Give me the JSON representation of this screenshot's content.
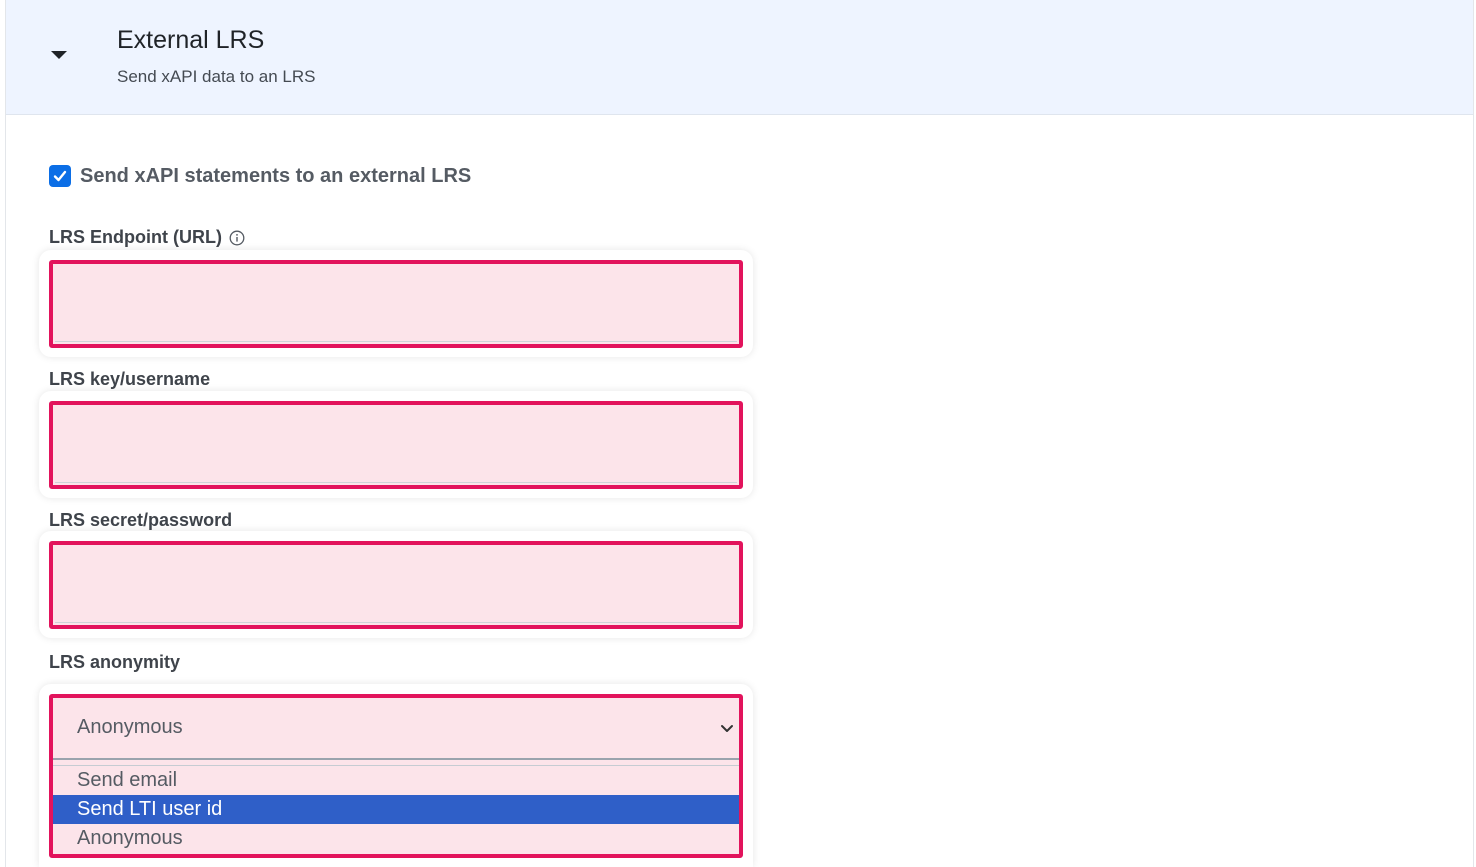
{
  "header": {
    "title": "External LRS",
    "subtitle": "Send xAPI data to an LRS",
    "toggle_icon": "caret-down-icon"
  },
  "send_checkbox": {
    "label": "Send xAPI statements to an external LRS",
    "checked": true,
    "accent_color": "#0b6ee6"
  },
  "endpoint": {
    "label": "LRS Endpoint (URL)",
    "value": "",
    "info_icon": "info-circle-icon"
  },
  "username": {
    "label": "LRS key/username",
    "value": ""
  },
  "password": {
    "label": "LRS secret/password",
    "value": ""
  },
  "anonymity": {
    "label": "LRS anonymity",
    "selected": "Anonymous",
    "options": [
      "Send email",
      "Send LTI user id",
      "Anonymous"
    ],
    "highlighted_option": "Send LTI user id"
  },
  "colors": {
    "error_border": "#e2135c",
    "error_fill": "#fce4ea",
    "header_bg": "#eef4ff",
    "highlight": "#2f5fc8"
  }
}
